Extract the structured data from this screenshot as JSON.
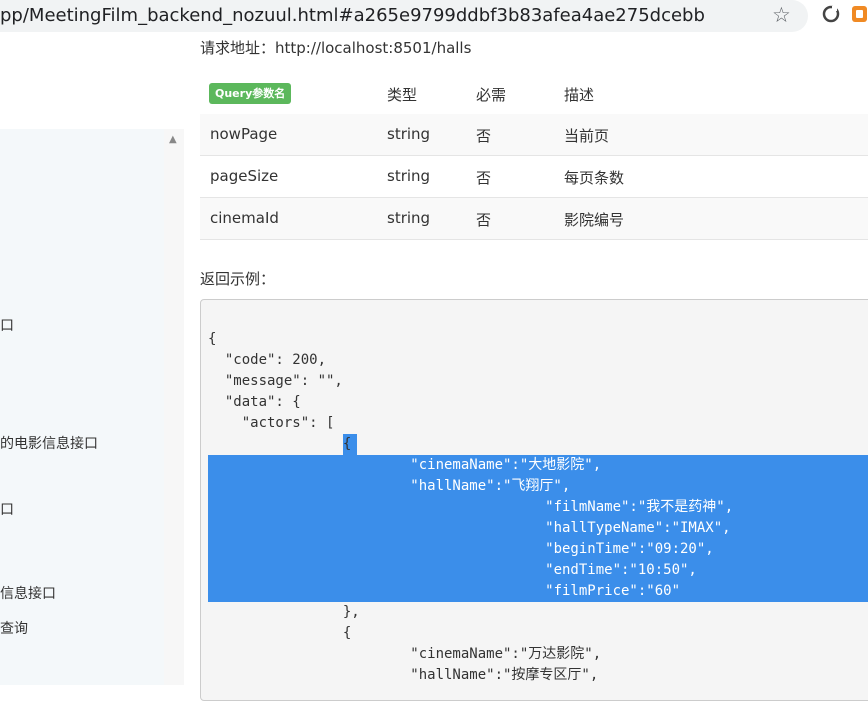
{
  "browser": {
    "url": "pp/MeetingFilm_backend_nozuul.html#a265e9799ddbf3b83afea4ae275dcebb"
  },
  "sidebar": {
    "items": [
      "口",
      "的电影信息接口",
      "口",
      "信息接口",
      "查询"
    ]
  },
  "request": {
    "url_label": "请求地址：http://localhost:8501/halls"
  },
  "params_table": {
    "badge": "Query参数名",
    "headers": [
      "类型",
      "必需",
      "描述"
    ],
    "rows": [
      {
        "name": "nowPage",
        "type": "string",
        "required": "否",
        "desc": "当前页"
      },
      {
        "name": "pageSize",
        "type": "string",
        "required": "否",
        "desc": "每页条数"
      },
      {
        "name": "cinemaId",
        "type": "string",
        "required": "否",
        "desc": "影院编号"
      }
    ]
  },
  "response": {
    "label": "返回示例：",
    "code_lines": [
      "{",
      "  \"code\": 200,",
      "  \"message\": \"\",",
      "  \"data\": {",
      "    \"actors\": [",
      "                {",
      "                        \"cinemaName\":\"大地影院\",",
      "                        \"hallName\":\"飞翔厅\",",
      "                                        \"filmName\":\"我不是药神\",",
      "                                        \"hallTypeName\":\"IMAX\",",
      "                                        \"beginTime\":\"09:20\",",
      "                                        \"endTime\":\"10:50\",",
      "                                        \"filmPrice\":\"60\"",
      "                },",
      "                {",
      "                        \"cinemaName\":\"万达影院\",",
      "                        \"hallName\":\"按摩专区厅\","
    ]
  },
  "colors": {
    "selection": "#3b8eea",
    "badge": "#5cb85c"
  }
}
